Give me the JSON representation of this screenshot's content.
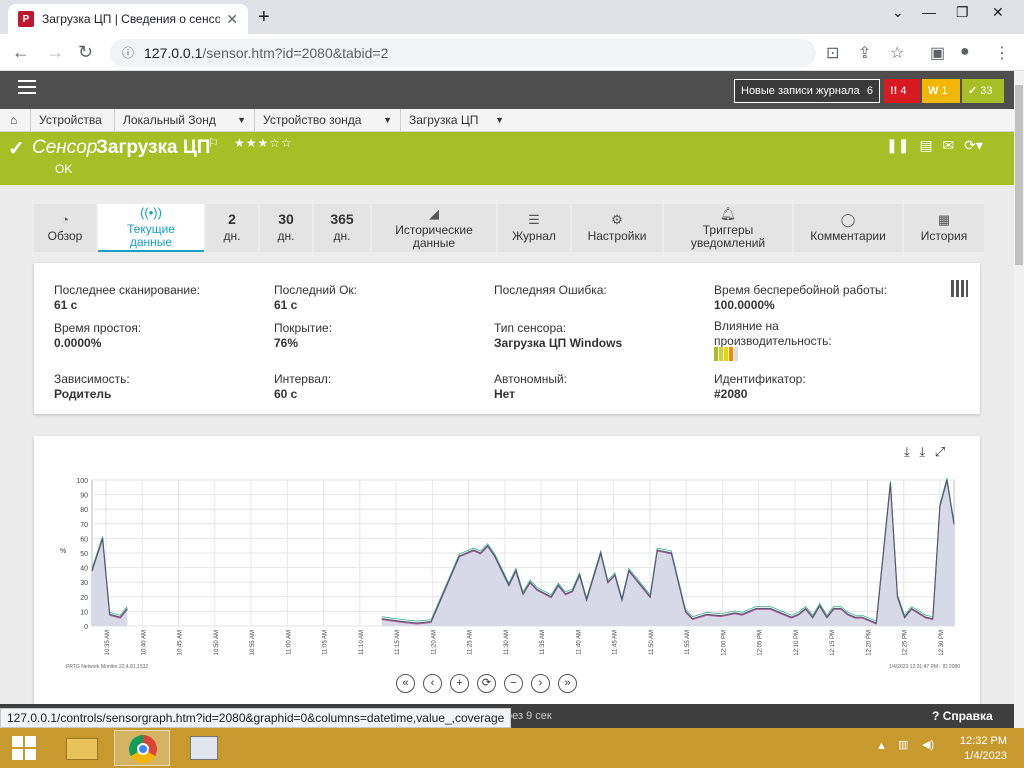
{
  "browser": {
    "tab_title": "Загрузка ЦП | Сведения о сенсо",
    "url_host": "127.0.0.1",
    "url_path": "/sensor.htm?id=2080&tabid=2"
  },
  "prtg_header": {
    "log_button": "Новые записи журнала",
    "log_count": "6",
    "alarm_count": "4",
    "warning_count": "1",
    "ok_count": "33"
  },
  "breadcrumbs": [
    {
      "label": "Устройства"
    },
    {
      "label": "Локальный Зонд"
    },
    {
      "label": "Устройство зонда"
    },
    {
      "label": "Загрузка ЦП"
    }
  ],
  "sensor": {
    "prefix": "Сенсор",
    "name": "Загрузка ЦП",
    "status": "OK",
    "stars": "★★★☆☆"
  },
  "tabs": [
    {
      "label": "Обзор",
      "icon": "gauge-icon"
    },
    {
      "label": "Текущие данные",
      "icon": "live-icon"
    },
    {
      "label": "2",
      "sub": "дн."
    },
    {
      "label": "30",
      "sub": "дн."
    },
    {
      "label": "365",
      "sub": "дн."
    },
    {
      "label": "Исторические данные",
      "icon": "area-chart-icon"
    },
    {
      "label": "Журнал",
      "icon": "log-icon"
    },
    {
      "label": "Настройки",
      "icon": "gear-icon"
    },
    {
      "label": "Триггеры уведомлений",
      "icon": "bell-icon"
    },
    {
      "label": "Комментарии",
      "icon": "comment-icon"
    },
    {
      "label": "История",
      "icon": "history-icon"
    }
  ],
  "info": {
    "last_scan_label": "Последнее сканирование:",
    "last_scan": "61 с",
    "last_ok_label": "Последний Ок:",
    "last_ok": "61 с",
    "last_error_label": "Последняя Ошибка:",
    "uptime_label": "Время бесперебойной работы:",
    "uptime": "100.0000%",
    "downtime_label": "Время простоя:",
    "downtime": "0.0000%",
    "coverage_label": "Покрытие:",
    "coverage": "76%",
    "sensor_type_label": "Тип сенсора:",
    "sensor_type": "Загрузка ЦП Windows",
    "perf_impact_label": "Влияние на производительность:",
    "dependency_label": "Зависимость:",
    "dependency": "Родитель",
    "interval_label": "Интервал:",
    "interval": "60 с",
    "autonomous_label": "Автономный:",
    "autonomous": "Нет",
    "identifier_label": "Идентификатор:",
    "identifier": "#2080"
  },
  "chart_data": {
    "type": "area",
    "ylabel": "%",
    "ylim": [
      0,
      100
    ],
    "yticks": [
      "0",
      "10",
      "20",
      "30",
      "40",
      "50",
      "60",
      "70",
      "80",
      "90",
      "100"
    ],
    "xticks": [
      "10:35 AM",
      "10:40 AM",
      "10:45 AM",
      "10:50 AM",
      "10:55 AM",
      "11:00 AM",
      "11:05 AM",
      "11:10 AM",
      "11:15 AM",
      "11:20 AM",
      "11:25 AM",
      "11:30 AM",
      "11:35 AM",
      "11:40 AM",
      "11:45 AM",
      "11:50 AM",
      "11:55 AM",
      "12:00 PM",
      "12:05 PM",
      "12:10 PM",
      "12:15 PM",
      "12:20 PM",
      "12:25 PM",
      "12:30 PM"
    ],
    "footer_left": "PRTG Network Monitor 22.4.81.1532",
    "footer_right": "1/4/2023 12:31:47 PM - ID 2080",
    "series": [
      {
        "values": [
          [
            0,
            38
          ],
          [
            1.5,
            60
          ],
          [
            2.5,
            8
          ],
          [
            4,
            6
          ],
          [
            5,
            12
          ]
        ]
      },
      {
        "values": [
          [
            41,
            5
          ],
          [
            44,
            3
          ],
          [
            46,
            2
          ],
          [
            48,
            3
          ],
          [
            52,
            48
          ],
          [
            54,
            52
          ],
          [
            55,
            50
          ],
          [
            56,
            55
          ],
          [
            57,
            48
          ],
          [
            59,
            28
          ],
          [
            60,
            38
          ],
          [
            61,
            22
          ],
          [
            62,
            30
          ],
          [
            63,
            25
          ],
          [
            65,
            20
          ],
          [
            66,
            28
          ],
          [
            67,
            22
          ],
          [
            68,
            24
          ],
          [
            69,
            35
          ],
          [
            70,
            18
          ],
          [
            72,
            50
          ],
          [
            73,
            30
          ],
          [
            74,
            35
          ],
          [
            75,
            18
          ],
          [
            76,
            38
          ],
          [
            77,
            32
          ],
          [
            79,
            20
          ],
          [
            80,
            52
          ],
          [
            82,
            50
          ],
          [
            84,
            10
          ],
          [
            85,
            5
          ],
          [
            87,
            8
          ],
          [
            89,
            7
          ],
          [
            91,
            9
          ],
          [
            92,
            8
          ],
          [
            94,
            12
          ],
          [
            96,
            12
          ],
          [
            97,
            10
          ],
          [
            98,
            8
          ],
          [
            99,
            6
          ],
          [
            100,
            8
          ],
          [
            101,
            12
          ],
          [
            102,
            6
          ],
          [
            103,
            14
          ],
          [
            104,
            6
          ],
          [
            105,
            12
          ],
          [
            106,
            12
          ],
          [
            107,
            8
          ],
          [
            108,
            6
          ],
          [
            109,
            6
          ],
          [
            110,
            4
          ],
          [
            111,
            2
          ],
          [
            113,
            98
          ],
          [
            114,
            20
          ],
          [
            115,
            6
          ],
          [
            116,
            12
          ],
          [
            118,
            6
          ],
          [
            119,
            5
          ],
          [
            120,
            82
          ],
          [
            121,
            100
          ],
          [
            122,
            70
          ]
        ]
      }
    ],
    "xmax": 122
  },
  "graph_nav": [
    "«",
    "‹",
    "+",
    "⟳",
    "−",
    "›",
    "»"
  ],
  "status_bar": {
    "url": "127.0.0.1/controls/sensorgraph.htm?id=2080&graphid=0&columns=datetime,value_,coverage",
    "refresh": "рез 9 сек",
    "help": "Справка"
  },
  "taskbar": {
    "time": "12:32 PM",
    "date": "1/4/2023"
  }
}
